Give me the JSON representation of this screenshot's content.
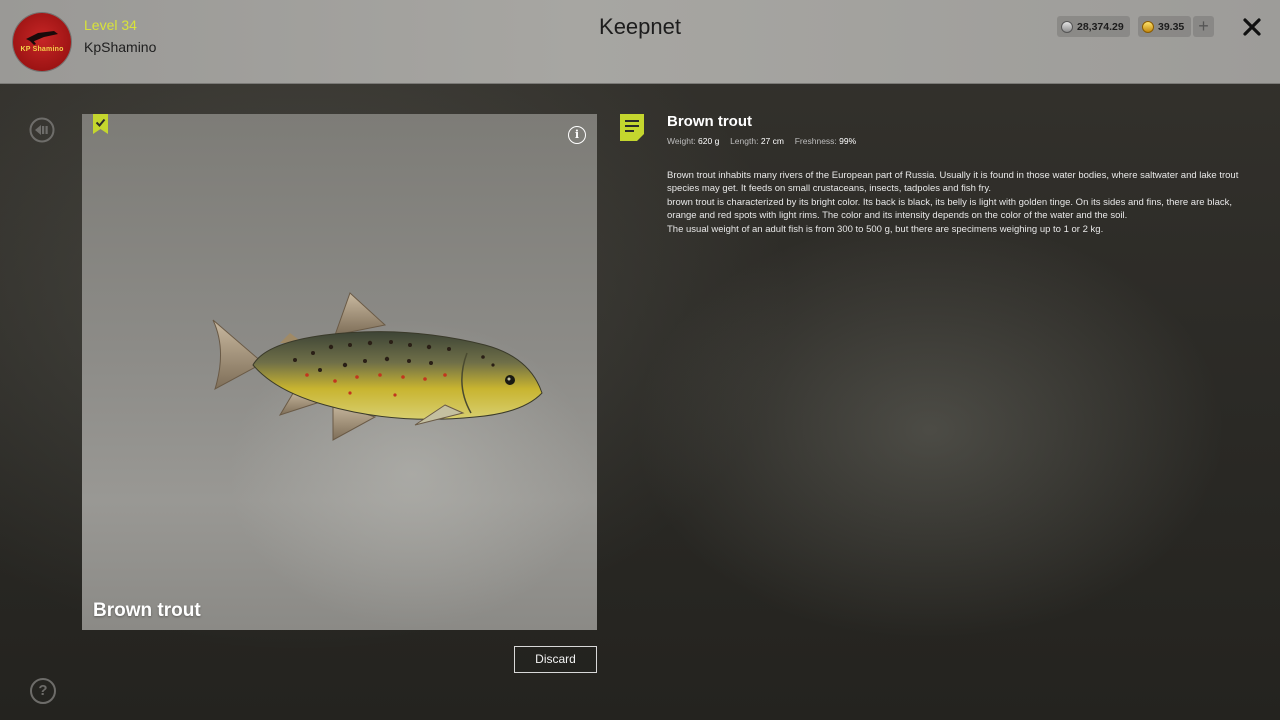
{
  "header": {
    "level_label": "Level 34",
    "username": "KpShamino",
    "avatar_text": "KP Shamino",
    "title": "Keepnet",
    "silver_amount": "28,374.29",
    "gold_amount": "39.35",
    "add_currency_symbol": "+"
  },
  "fish": {
    "name": "Brown trout",
    "caption": "Brown trout",
    "stats": {
      "weight_label": "Weight:",
      "weight_value": "620 g",
      "length_label": "Length:",
      "length_value": "27 cm",
      "freshness_label": "Freshness:",
      "freshness_value": "99%"
    },
    "description": [
      "Brown trout inhabits many rivers of the European part of Russia. Usually it is found in those water bodies, where saltwater and lake trout species may get. It feeds on small crustaceans, insects, tadpoles and fish fry.",
      "brown trout is characterized by its bright color. Its back is black, its belly is light with golden tinge. On its sides and fins, there are black, orange and red spots with light rims. The color and its intensity depends on the color of the water and the soil.",
      "The usual weight of an adult fish is from 300 to 500 g, but there are specimens weighing up to 1 or 2 kg."
    ]
  },
  "actions": {
    "discard_label": "Discard",
    "help_symbol": "?",
    "info_symbol": "i"
  },
  "colors": {
    "level_accent": "#d8e33a",
    "panel_accent": "#c4d62e"
  },
  "icons": [
    "avatar-logo",
    "silver-coin-icon",
    "gold-coin-icon",
    "plus-icon",
    "close-icon",
    "back-icon",
    "help-icon",
    "bookmark-icon",
    "info-icon",
    "note-icon"
  ]
}
